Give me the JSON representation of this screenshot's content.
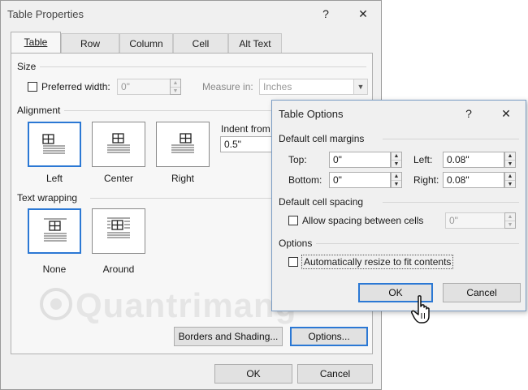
{
  "table_properties": {
    "title": "Table Properties",
    "help_btn": "?",
    "close_btn": "✕",
    "tabs": [
      {
        "label": "Table",
        "active": true
      },
      {
        "label": "Row",
        "active": false
      },
      {
        "label": "Column",
        "active": false
      },
      {
        "label": "Cell",
        "active": false
      },
      {
        "label": "Alt Text",
        "active": false
      }
    ],
    "size": {
      "group_label": "Size",
      "preferred_width_label": "Preferred width:",
      "preferred_width_value": "0\"",
      "measure_in_label": "Measure in:",
      "measure_in_value": "Inches"
    },
    "alignment": {
      "group_label": "Alignment",
      "options": [
        {
          "label": "Left",
          "selected": true
        },
        {
          "label": "Center",
          "selected": false
        },
        {
          "label": "Right",
          "selected": false
        }
      ],
      "indent_label": "Indent from l",
      "indent_value": "0.5\""
    },
    "text_wrapping": {
      "group_label": "Text wrapping",
      "options": [
        {
          "label": "None",
          "selected": true
        },
        {
          "label": "Around",
          "selected": false
        }
      ]
    },
    "borders_btn": "Borders and Shading...",
    "options_btn": "Options...",
    "ok_btn": "OK",
    "cancel_btn": "Cancel"
  },
  "table_options": {
    "title": "Table Options",
    "help_btn": "?",
    "close_btn": "✕",
    "margins": {
      "group_label": "Default cell margins",
      "top_label": "Top:",
      "top_value": "0\"",
      "bottom_label": "Bottom:",
      "bottom_value": "0\"",
      "left_label": "Left:",
      "left_value": "0.08\"",
      "right_label": "Right:",
      "right_value": "0.08\""
    },
    "spacing": {
      "group_label": "Default cell spacing",
      "allow_label": "Allow spacing between cells",
      "allow_value": "0\""
    },
    "options": {
      "group_label": "Options",
      "auto_resize_label": "Automatically resize to fit contents"
    },
    "ok_btn": "OK",
    "cancel_btn": "Cancel"
  },
  "watermark": "Quantrimang",
  "colors": {
    "accent": "#2b78d4",
    "dialog_bg": "#f0f0f0"
  }
}
